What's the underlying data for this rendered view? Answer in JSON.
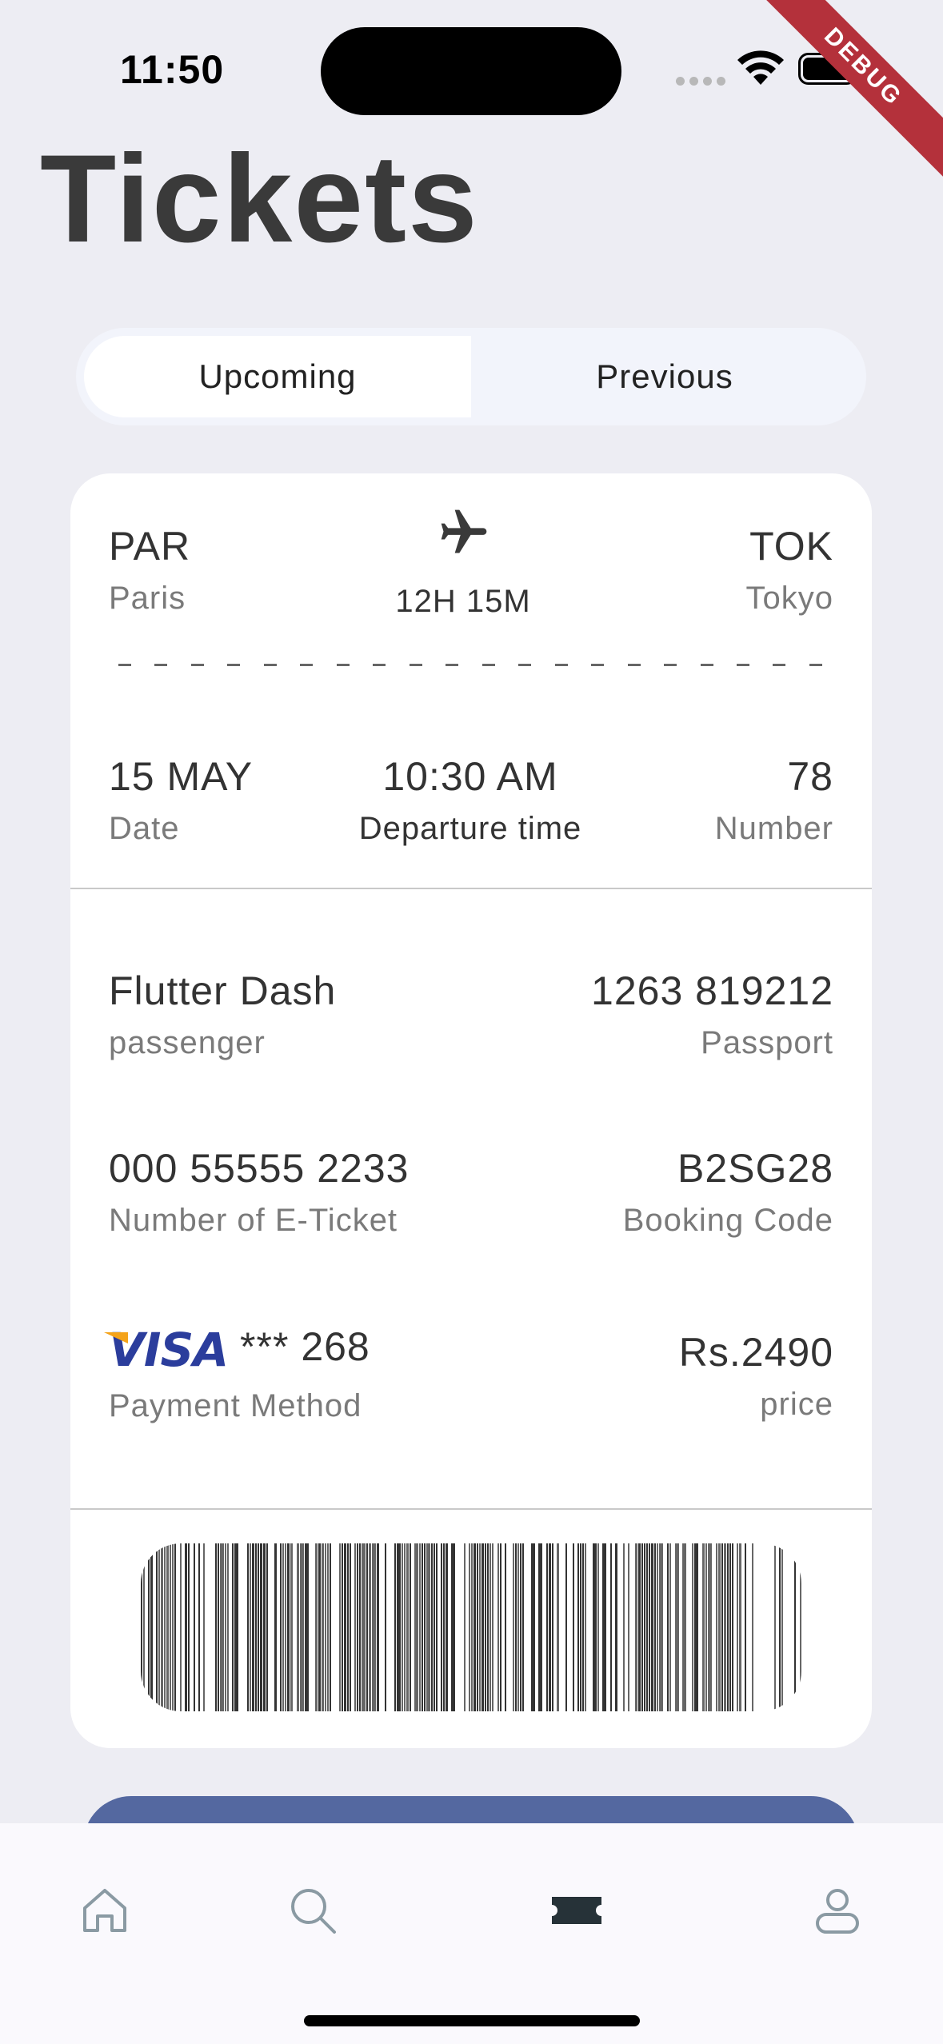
{
  "status_bar": {
    "time": "11:50"
  },
  "debug_label": "DEBUG",
  "title": "Tickets",
  "tabs": [
    {
      "label": "Upcoming",
      "active": true
    },
    {
      "label": "Previous",
      "active": false
    }
  ],
  "ticket": {
    "from": {
      "code": "PAR",
      "city": "Paris"
    },
    "to": {
      "code": "TOK",
      "city": "Tokyo"
    },
    "duration": "12H 15M",
    "date": {
      "value": "15 MAY",
      "label": "Date"
    },
    "departure": {
      "value": "10:30 AM",
      "label": "Departure time"
    },
    "number": {
      "value": "78",
      "label": "Number"
    },
    "passenger": {
      "value": "Flutter Dash",
      "label": "passenger"
    },
    "passport": {
      "value": "1263 819212",
      "label": "Passport"
    },
    "eticket": {
      "value": "000 55555 2233",
      "label": "Number of E-Ticket"
    },
    "booking": {
      "value": "B2SG28",
      "label": "Booking Code"
    },
    "payment": {
      "brand": "VISA",
      "value": "*** 268",
      "label": "Payment Method"
    },
    "price": {
      "value": "Rs.2490",
      "label": "price"
    }
  },
  "icons": {
    "plane": "airplane-icon",
    "nav": [
      "home-icon",
      "search-icon",
      "ticket-icon",
      "profile-icon"
    ]
  },
  "colors": {
    "background": "#ededf3",
    "card": "#ffffff",
    "accent": "#5468a0",
    "debug": "#b4313b",
    "visa_blue": "#2b3d9c",
    "visa_gold": "#f4a31a"
  }
}
